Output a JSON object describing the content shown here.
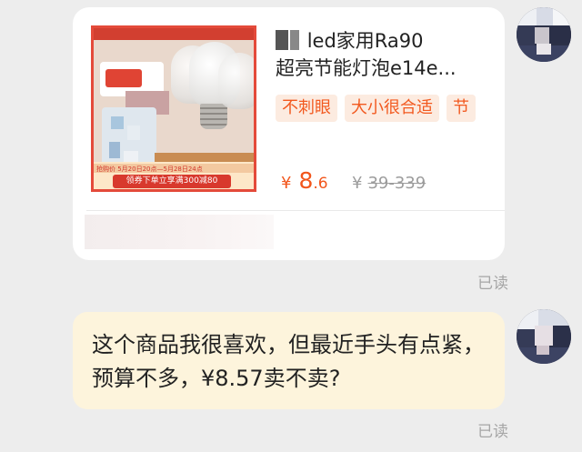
{
  "product_card": {
    "title": "led家用Ra90超亮节能灯泡e14e...",
    "title_line1": "led家用Ra90",
    "title_line2": "超亮节能灯泡e14e...",
    "tags": [
      "不刺眼",
      "大小很合适",
      "节"
    ],
    "price_currency": "¥",
    "price_integer": "8",
    "price_decimal": ".6",
    "original_price_currency": "¥",
    "original_price_range": "39-339",
    "thumbnail": {
      "coupon_text": "领券下单立享满300减80",
      "promo_text": "抢购价 5月20日20点—5月28日24点"
    }
  },
  "messages": [
    {
      "type": "product-card",
      "status": "已读"
    },
    {
      "type": "text",
      "text": "这个商品我很喜欢，但最近手头有点紧，预算不多，¥8.57卖不卖?",
      "status": "已读"
    }
  ],
  "colors": {
    "background": "#ededed",
    "accent_orange": "#f2561c",
    "tag_bg": "#fcebe0",
    "bubble_bg": "#fdf4dc"
  }
}
